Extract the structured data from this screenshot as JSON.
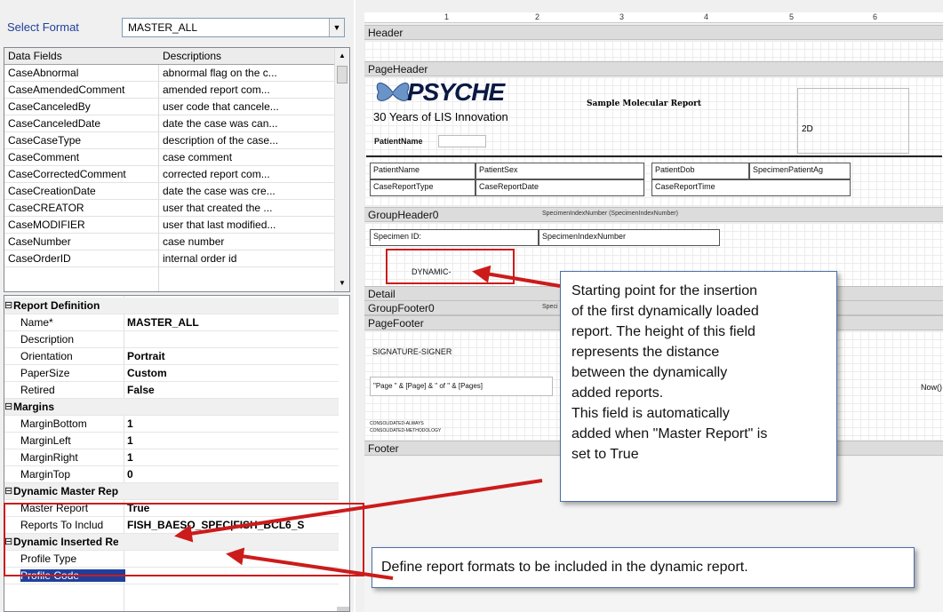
{
  "format_selector": {
    "label": "Select Format",
    "value": "MASTER_ALL"
  },
  "fields_table": {
    "headers": [
      "Data Fields",
      "Descriptions"
    ],
    "rows": [
      [
        "CaseAbnormal",
        "abnormal flag on the c..."
      ],
      [
        "CaseAmendedComment",
        "amended report com..."
      ],
      [
        "CaseCanceledBy",
        "user code that cancele..."
      ],
      [
        "CaseCanceledDate",
        "date the case was can..."
      ],
      [
        "CaseCaseType",
        "description of the case..."
      ],
      [
        "CaseComment",
        "case comment"
      ],
      [
        "CaseCorrectedComment",
        "corrected report com..."
      ],
      [
        "CaseCreationDate",
        "date the case was cre..."
      ],
      [
        "CaseCREATOR",
        "user that created the ..."
      ],
      [
        "CaseMODIFIER",
        "user that last modified..."
      ],
      [
        "CaseNumber",
        "case number"
      ],
      [
        "CaseOrderID",
        "internal order id"
      ]
    ]
  },
  "properties": [
    {
      "type": "section",
      "name": "Report Definition"
    },
    {
      "type": "prop",
      "name": "Name*",
      "value": "MASTER_ALL"
    },
    {
      "type": "prop",
      "name": "Description",
      "value": ""
    },
    {
      "type": "prop",
      "name": "Orientation",
      "value": "Portrait"
    },
    {
      "type": "prop",
      "name": "PaperSize",
      "value": "Custom"
    },
    {
      "type": "prop",
      "name": "Retired",
      "value": "False"
    },
    {
      "type": "section",
      "name": "Margins"
    },
    {
      "type": "prop",
      "name": "MarginBottom",
      "value": "1"
    },
    {
      "type": "prop",
      "name": "MarginLeft",
      "value": "1"
    },
    {
      "type": "prop",
      "name": "MarginRight",
      "value": "1"
    },
    {
      "type": "prop",
      "name": "MarginTop",
      "value": "0"
    },
    {
      "type": "section",
      "name": "Dynamic Master Report"
    },
    {
      "type": "prop",
      "name": "Master Report",
      "value": "True"
    },
    {
      "type": "prop",
      "name": "Reports To Includ",
      "value": "FISH_BAESO_SPEC|FISH_BCL6_S"
    },
    {
      "type": "section",
      "name": "Dynamic Inserted Report"
    },
    {
      "type": "prop",
      "name": "Profile Type",
      "value": ""
    },
    {
      "type": "prop",
      "name": "Profile Code",
      "value": "",
      "selected": true
    }
  ],
  "designer": {
    "ruler": [
      "1",
      "2",
      "3",
      "4",
      "5",
      "6"
    ],
    "bands": {
      "header": "Header",
      "page_header": "PageHeader",
      "group_header": "GroupHeader0",
      "group_header_note": "SpecimenIndexNumber (SpecimenIndexNumber)",
      "detail": "Detail",
      "group_footer": "GroupFooter0",
      "group_footer_note": "Speci",
      "page_footer": "PageFooter",
      "footer": "Footer"
    },
    "logo": {
      "name": "PSYCHE",
      "tagline": "30 Years of LIS Innovation"
    },
    "report_title": "Sample Molecular Report",
    "barcode_label": "2D",
    "fields": {
      "patient_name_label": "PatientName",
      "patient_name": "PatientName",
      "patient_sex": "PatientSex",
      "patient_dob": "PatientDob",
      "specimen_patient_age": "SpecimenPatientAg",
      "case_report_type": "CaseReportType",
      "case_report_date": "CaseReportDate",
      "case_report_time": "CaseReportTime",
      "specimen_id_label": "Specimen ID:",
      "specimen_index_number": "SpecimenIndexNumber",
      "dynamic": "DYNAMIC-",
      "signature": "SIGNATURE-SIGNER",
      "page_expr": "\"Page \" & [Page] & \" of \" & [Pages]",
      "now": "Now()",
      "consolidated_always": "CONSOLIDATED-ALWAYS",
      "consolidated_methodology": "CONSOLIDATED-METHODOLOGY"
    }
  },
  "callouts": {
    "dynamic_note": [
      "Starting point for the insertion",
      "of the first dynamically loaded",
      "report. The height of this field",
      "represents the distance",
      "between the dynamically",
      "added reports.",
      "This field is automatically",
      "added when \"Master Report\" is",
      "set to True"
    ],
    "formats_note": "Define report formats to be included in the dynamic report."
  },
  "colors": {
    "annotation_red": "#cc1b1b",
    "selection_blue": "#1f3f9a"
  }
}
